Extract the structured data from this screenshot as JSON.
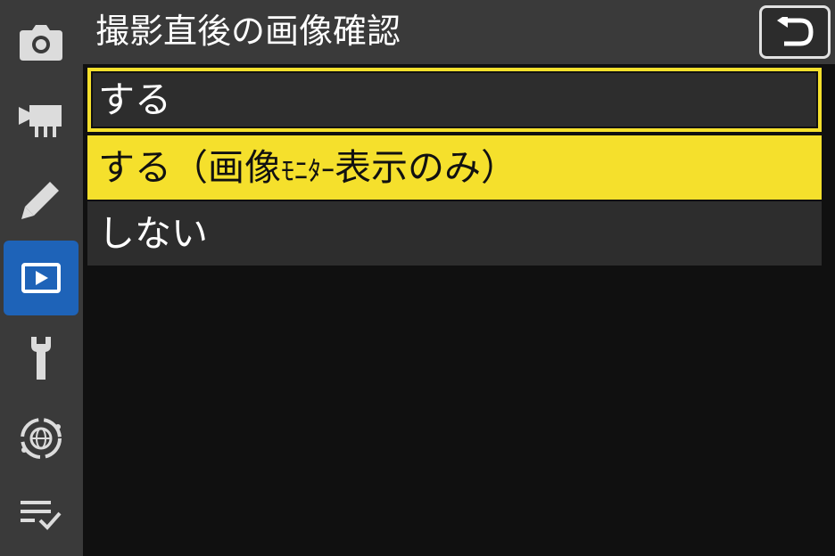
{
  "header": {
    "title": "撮影直後の画像確認",
    "back_icon": "back-arrow-icon"
  },
  "sidebar": {
    "tabs": [
      {
        "id": "photo-shooting",
        "icon": "camera-icon",
        "active": false
      },
      {
        "id": "movie-recording",
        "icon": "movie-camera-icon",
        "active": false
      },
      {
        "id": "custom-settings",
        "icon": "pencil-icon",
        "active": false
      },
      {
        "id": "playback",
        "icon": "playback-icon",
        "active": true
      },
      {
        "id": "setup",
        "icon": "wrench-icon",
        "active": false
      },
      {
        "id": "network",
        "icon": "network-globe-icon",
        "active": false
      },
      {
        "id": "my-menu",
        "icon": "my-menu-icon",
        "active": false
      }
    ]
  },
  "options": {
    "items": [
      {
        "label": "する",
        "state": "focused"
      },
      {
        "label_main": "する（画像",
        "label_small": "ﾓﾆﾀｰ",
        "label_end": "表示のみ）",
        "state": "selected"
      },
      {
        "label": "しない",
        "state": "normal"
      }
    ]
  },
  "colors": {
    "highlight": "#f5e02c",
    "active_tab": "#1e63b8",
    "sidebar_bg": "#3a3a3a",
    "row_bg": "#2d2d2d"
  }
}
